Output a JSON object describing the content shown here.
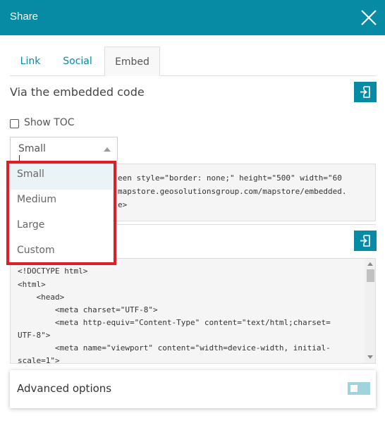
{
  "header": {
    "title": "Share"
  },
  "tabs": [
    {
      "label": "Link",
      "active": false
    },
    {
      "label": "Social",
      "active": false
    },
    {
      "label": "Embed",
      "active": true
    }
  ],
  "embed": {
    "title": "Via the embedded code",
    "show_toc_label": "Show TOC",
    "show_toc_checked": false,
    "size_select": {
      "selected": "Small",
      "options": [
        "Small",
        "Medium",
        "Large",
        "Custom"
      ]
    },
    "iframe_code_lines": [
      "een style=\"border: none;\" height=\"500\" width=\"60",
      "mapstore.geosolutionsgroup.com/mapstore/embedded.",
      "e>"
    ],
    "html_code_lines": [
      "<!DOCTYPE html>",
      "<html>",
      "    <head>",
      "        <meta charset=\"UTF-8\">",
      "        <meta http-equiv=\"Content-Type\" content=\"text/html;charset=",
      "UTF-8\">",
      "        <meta name=\"viewport\" content=\"width=device-width, initial-",
      "scale=1\">"
    ]
  },
  "advanced": {
    "label": "Advanced options",
    "enabled": false
  },
  "colors": {
    "accent": "#078aa3",
    "highlight": "#dc1f26",
    "toggle_off": "#9fd3de"
  },
  "icons": {
    "close": "close-icon",
    "copy": "copy-to-clipboard-icon"
  }
}
